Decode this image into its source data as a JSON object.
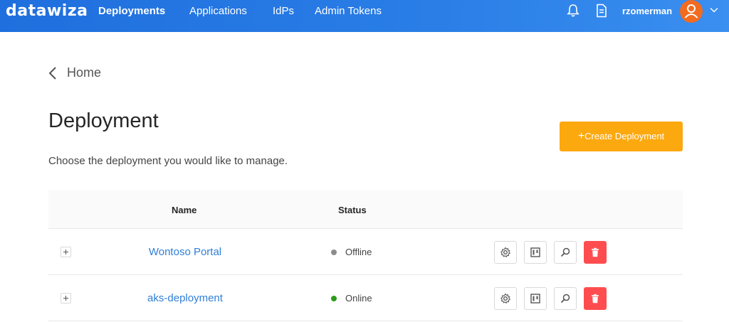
{
  "brand": {
    "logo": "datawiza"
  },
  "nav": {
    "items": [
      {
        "label": "Deployments",
        "active": true
      },
      {
        "label": "Applications",
        "active": false
      },
      {
        "label": "IdPs",
        "active": false
      },
      {
        "label": "Admin Tokens",
        "active": false
      }
    ],
    "user": {
      "name": "rzomerman",
      "avatar_color": "#f26b1f"
    },
    "icons": [
      "bell-icon",
      "document-icon",
      "user-icon",
      "chevron-down-icon"
    ]
  },
  "breadcrumb": {
    "back_label": "Home"
  },
  "page": {
    "title": "Deployment",
    "subtitle": "Choose the deployment you would like to manage.",
    "create_button": {
      "prefix": "+",
      "label": "Create Deployment",
      "color": "#fca80f"
    }
  },
  "table": {
    "columns": [
      "Name",
      "Status"
    ],
    "rows": [
      {
        "name": "Wontoso Portal",
        "status": "Offline",
        "status_color": "#8c8c8c"
      },
      {
        "name": "aks-deployment",
        "status": "Online",
        "status_color": "#2a9d1a"
      }
    ],
    "row_actions": [
      "settings-icon",
      "board-icon",
      "search-icon",
      "delete-icon"
    ]
  },
  "colors": {
    "header": "#1f6fde",
    "link": "#2f7fd6",
    "danger": "#ff4d4f"
  }
}
